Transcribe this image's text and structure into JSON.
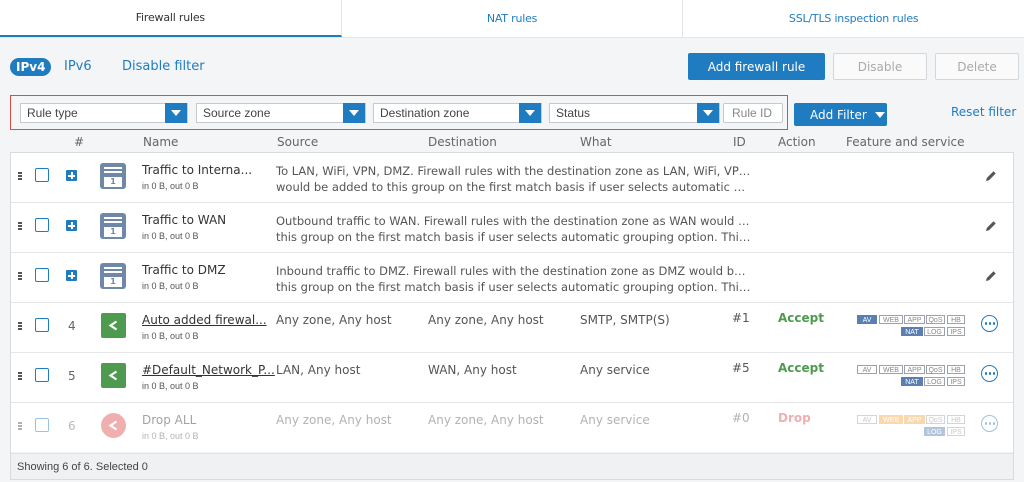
{
  "tabs": [
    {
      "label": "Firewall rules",
      "active": true
    },
    {
      "label": "NAT rules",
      "active": false
    },
    {
      "label": "SSL/TLS inspection rules",
      "active": false
    }
  ],
  "toolbar": {
    "ipv4": "IPv4",
    "ipv6": "IPv6",
    "disable_filter": "Disable filter",
    "add_rule": "Add firewall rule",
    "disable": "Disable",
    "delete": "Delete"
  },
  "filters": {
    "rule_type": "Rule type",
    "source_zone": "Source zone",
    "destination_zone": "Destination zone",
    "status": "Status",
    "rule_id_placeholder": "Rule ID",
    "add_filter": "Add Filter",
    "reset_filter": "Reset filter"
  },
  "columns": {
    "num": "#",
    "name": "Name",
    "source": "Source",
    "destination": "Destination",
    "what": "What",
    "id": "ID",
    "action": "Action",
    "feature": "Feature and service"
  },
  "groups": [
    {
      "name": "Traffic to Interna...",
      "stats": "in 0 B, out 0 B",
      "desc1": "To LAN, WiFi, VPN, DMZ. Firewall rules with the destination zone as LAN, WiFi, VPN, DMZ",
      "desc2": "would be added to this group on the first match basis if user selects automatic grouping...",
      "count": "1"
    },
    {
      "name": "Traffic to WAN",
      "stats": "in 0 B, out 0 B",
      "desc1": "Outbound traffic to WAN. Firewall rules with the destination zone as WAN would be added to",
      "desc2": "this group on the first match basis if user selects automatic grouping option. This is the d...",
      "count": "1"
    },
    {
      "name": "Traffic to DMZ",
      "stats": "in 0 B, out 0 B",
      "desc1": "Inbound traffic to DMZ. Firewall rules with the destination zone as DMZ would be added to",
      "desc2": "this group on the first match basis if user selects automatic grouping option. This is the de...",
      "count": "1"
    }
  ],
  "rules": [
    {
      "num": "4",
      "name": "Auto added firewal...",
      "stats": "in 0 B, out 0 B",
      "source": "Any zone, Any host",
      "destination": "Any zone, Any host",
      "what": "SMTP, SMTP(S)",
      "id": "#1",
      "action": "Accept",
      "badges": [
        "AV",
        "WEB",
        "APP",
        "QoS",
        "HB",
        "NAT",
        "LOG",
        "IPS"
      ]
    },
    {
      "num": "5",
      "name": "#Default_Network_P...",
      "stats": "in 0 B, out 0 B",
      "source": "LAN, Any host",
      "destination": "WAN, Any host",
      "what": "Any service",
      "id": "#5",
      "action": "Accept",
      "badges": [
        "AV",
        "WEB",
        "APP",
        "QoS",
        "HB",
        "NAT",
        "LOG",
        "IPS"
      ]
    },
    {
      "num": "6",
      "name": "Drop ALL",
      "stats": "in 0 B, out 0 B",
      "source": "Any zone, Any host",
      "destination": "Any zone, Any host",
      "what": "Any service",
      "id": "#0",
      "action": "Drop",
      "badges": [
        "AV",
        "WEB",
        "APP",
        "QoS",
        "HB",
        "LOG",
        "IPS"
      ]
    }
  ],
  "footer": "Showing 6 of 6. Selected 0",
  "colors": {
    "accent": "#1f7cc1",
    "accept": "#4e9a4e",
    "drop": "#e05050",
    "highlight_border": "#e04a4a"
  }
}
